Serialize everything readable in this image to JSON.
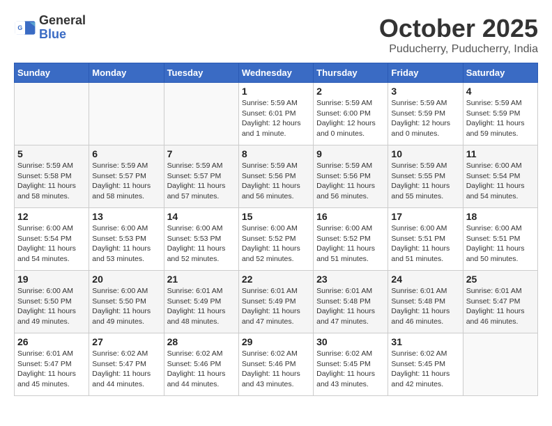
{
  "logo": {
    "general": "General",
    "blue": "Blue"
  },
  "title": {
    "month": "October 2025",
    "location": "Puducherry, Puducherry, India"
  },
  "weekdays": [
    "Sunday",
    "Monday",
    "Tuesday",
    "Wednesday",
    "Thursday",
    "Friday",
    "Saturday"
  ],
  "weeks": [
    [
      {
        "day": "",
        "info": ""
      },
      {
        "day": "",
        "info": ""
      },
      {
        "day": "",
        "info": ""
      },
      {
        "day": "1",
        "info": "Sunrise: 5:59 AM\nSunset: 6:01 PM\nDaylight: 12 hours\nand 1 minute."
      },
      {
        "day": "2",
        "info": "Sunrise: 5:59 AM\nSunset: 6:00 PM\nDaylight: 12 hours\nand 0 minutes."
      },
      {
        "day": "3",
        "info": "Sunrise: 5:59 AM\nSunset: 5:59 PM\nDaylight: 12 hours\nand 0 minutes."
      },
      {
        "day": "4",
        "info": "Sunrise: 5:59 AM\nSunset: 5:59 PM\nDaylight: 11 hours\nand 59 minutes."
      }
    ],
    [
      {
        "day": "5",
        "info": "Sunrise: 5:59 AM\nSunset: 5:58 PM\nDaylight: 11 hours\nand 58 minutes."
      },
      {
        "day": "6",
        "info": "Sunrise: 5:59 AM\nSunset: 5:57 PM\nDaylight: 11 hours\nand 58 minutes."
      },
      {
        "day": "7",
        "info": "Sunrise: 5:59 AM\nSunset: 5:57 PM\nDaylight: 11 hours\nand 57 minutes."
      },
      {
        "day": "8",
        "info": "Sunrise: 5:59 AM\nSunset: 5:56 PM\nDaylight: 11 hours\nand 56 minutes."
      },
      {
        "day": "9",
        "info": "Sunrise: 5:59 AM\nSunset: 5:56 PM\nDaylight: 11 hours\nand 56 minutes."
      },
      {
        "day": "10",
        "info": "Sunrise: 5:59 AM\nSunset: 5:55 PM\nDaylight: 11 hours\nand 55 minutes."
      },
      {
        "day": "11",
        "info": "Sunrise: 6:00 AM\nSunset: 5:54 PM\nDaylight: 11 hours\nand 54 minutes."
      }
    ],
    [
      {
        "day": "12",
        "info": "Sunrise: 6:00 AM\nSunset: 5:54 PM\nDaylight: 11 hours\nand 54 minutes."
      },
      {
        "day": "13",
        "info": "Sunrise: 6:00 AM\nSunset: 5:53 PM\nDaylight: 11 hours\nand 53 minutes."
      },
      {
        "day": "14",
        "info": "Sunrise: 6:00 AM\nSunset: 5:53 PM\nDaylight: 11 hours\nand 52 minutes."
      },
      {
        "day": "15",
        "info": "Sunrise: 6:00 AM\nSunset: 5:52 PM\nDaylight: 11 hours\nand 52 minutes."
      },
      {
        "day": "16",
        "info": "Sunrise: 6:00 AM\nSunset: 5:52 PM\nDaylight: 11 hours\nand 51 minutes."
      },
      {
        "day": "17",
        "info": "Sunrise: 6:00 AM\nSunset: 5:51 PM\nDaylight: 11 hours\nand 51 minutes."
      },
      {
        "day": "18",
        "info": "Sunrise: 6:00 AM\nSunset: 5:51 PM\nDaylight: 11 hours\nand 50 minutes."
      }
    ],
    [
      {
        "day": "19",
        "info": "Sunrise: 6:00 AM\nSunset: 5:50 PM\nDaylight: 11 hours\nand 49 minutes."
      },
      {
        "day": "20",
        "info": "Sunrise: 6:00 AM\nSunset: 5:50 PM\nDaylight: 11 hours\nand 49 minutes."
      },
      {
        "day": "21",
        "info": "Sunrise: 6:01 AM\nSunset: 5:49 PM\nDaylight: 11 hours\nand 48 minutes."
      },
      {
        "day": "22",
        "info": "Sunrise: 6:01 AM\nSunset: 5:49 PM\nDaylight: 11 hours\nand 47 minutes."
      },
      {
        "day": "23",
        "info": "Sunrise: 6:01 AM\nSunset: 5:48 PM\nDaylight: 11 hours\nand 47 minutes."
      },
      {
        "day": "24",
        "info": "Sunrise: 6:01 AM\nSunset: 5:48 PM\nDaylight: 11 hours\nand 46 minutes."
      },
      {
        "day": "25",
        "info": "Sunrise: 6:01 AM\nSunset: 5:47 PM\nDaylight: 11 hours\nand 46 minutes."
      }
    ],
    [
      {
        "day": "26",
        "info": "Sunrise: 6:01 AM\nSunset: 5:47 PM\nDaylight: 11 hours\nand 45 minutes."
      },
      {
        "day": "27",
        "info": "Sunrise: 6:02 AM\nSunset: 5:47 PM\nDaylight: 11 hours\nand 44 minutes."
      },
      {
        "day": "28",
        "info": "Sunrise: 6:02 AM\nSunset: 5:46 PM\nDaylight: 11 hours\nand 44 minutes."
      },
      {
        "day": "29",
        "info": "Sunrise: 6:02 AM\nSunset: 5:46 PM\nDaylight: 11 hours\nand 43 minutes."
      },
      {
        "day": "30",
        "info": "Sunrise: 6:02 AM\nSunset: 5:45 PM\nDaylight: 11 hours\nand 43 minutes."
      },
      {
        "day": "31",
        "info": "Sunrise: 6:02 AM\nSunset: 5:45 PM\nDaylight: 11 hours\nand 42 minutes."
      },
      {
        "day": "",
        "info": ""
      }
    ]
  ]
}
